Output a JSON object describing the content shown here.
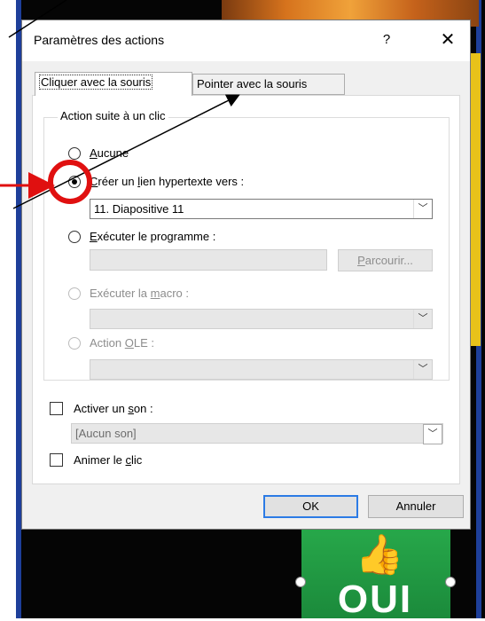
{
  "window": {
    "title": "Paramètres des actions",
    "help_label": "?",
    "close_label": "✕"
  },
  "tabs": [
    {
      "label": "Cliquer avec la souris",
      "selected": true
    },
    {
      "label": "Pointer avec la souris",
      "selected": false
    }
  ],
  "group": {
    "legend": "Action suite à un clic",
    "options": {
      "none": {
        "pre": "",
        "acc": "A",
        "post": "ucune",
        "selected": false,
        "enabled": true
      },
      "hyperlink": {
        "pre": "",
        "acc": "C",
        "post": "réer un ",
        "acc2": "l",
        "post2": "ien hypertexte vers :",
        "selected": true,
        "enabled": true
      },
      "program": {
        "pre": "",
        "acc": "E",
        "post": "xécuter le programme :",
        "selected": false,
        "enabled": true
      },
      "macro": {
        "pre": "Exécuter la ",
        "acc": "m",
        "post": "acro :",
        "selected": false,
        "enabled": false
      },
      "ole": {
        "pre": "Action ",
        "acc": "O",
        "post": "LE :",
        "selected": false,
        "enabled": false
      }
    },
    "hyperlink_value": "11. Diapositive 11",
    "program_value": "",
    "browse": {
      "pre": "",
      "acc": "P",
      "post": "arcourir..."
    },
    "macro_value": "",
    "ole_value": ""
  },
  "sound": {
    "checkbox": {
      "pre": "Activer un ",
      "acc": "s",
      "post": "on :",
      "checked": false
    },
    "value": "[Aucun son]"
  },
  "animate": {
    "pre": "Animer le ",
    "acc": "c",
    "post": "lic",
    "checked": false
  },
  "buttons": {
    "ok": "OK",
    "cancel": "Annuler"
  },
  "background": {
    "slide_button_text": "OUI"
  },
  "colors": {
    "annotation": "#e01010",
    "accent": "#2c7be5",
    "slide_green": "#1f9a42"
  }
}
